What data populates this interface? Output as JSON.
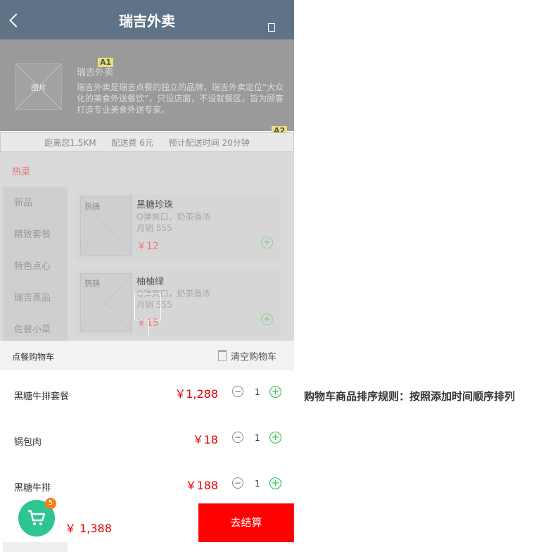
{
  "header": {
    "title": "瑞吉外卖",
    "back_icon": "back-chevron-icon",
    "menu_icon": "menu-icon"
  },
  "store": {
    "image_label": "图片",
    "name": "瑞吉外卖",
    "description": "瑞吉外卖是瑞吉点餐的独立的品牌，瑞吉外卖定位“大众化的美食外送餐饮”，只设店面，不设就餐区，旨为顾客打造专业美食外送专家。",
    "tag_a1": "A1",
    "tag_a2": "A2"
  },
  "info": {
    "distance": "距离您1.5KM",
    "fee": "配送费 6元",
    "time": "预计配送时间 20分钟"
  },
  "menu": {
    "hot_label": "热菜",
    "categories": [
      "新品",
      "精致套餐",
      "特色点心",
      "瑞吉蒸品",
      "佐餐小菜"
    ],
    "items": [
      {
        "badge": "热销",
        "name": "黑糖珍珠",
        "desc": "Q弹爽口，奶茶香浓",
        "sales": "月销 555",
        "price": "￥12"
      },
      {
        "badge": "热销",
        "name": "柚柚绿",
        "desc": "Q弹爽口，奶茶香浓",
        "sales": "月销 555",
        "price": "￥15"
      }
    ]
  },
  "cart": {
    "title": "点餐购物车",
    "clear_label": "清空购物车",
    "rows": [
      {
        "name": "黑糖牛排套餐",
        "price": "￥1,288",
        "qty": "1"
      },
      {
        "name": "锅包肉",
        "price": "￥18",
        "qty": "1"
      },
      {
        "name": "黑糖牛排",
        "price": "￥188",
        "qty": "1"
      }
    ],
    "badge_count": "5",
    "total": "￥ 1,388",
    "checkout_label": "去结算"
  },
  "note": "购物车商品排序规则：按照添加时间顺序排列",
  "colors": {
    "header": "#5f7386",
    "checkout": "#ff0000",
    "cart_fab": "#2dc693",
    "price": "#e60000",
    "badge": "#ff7b1a"
  }
}
